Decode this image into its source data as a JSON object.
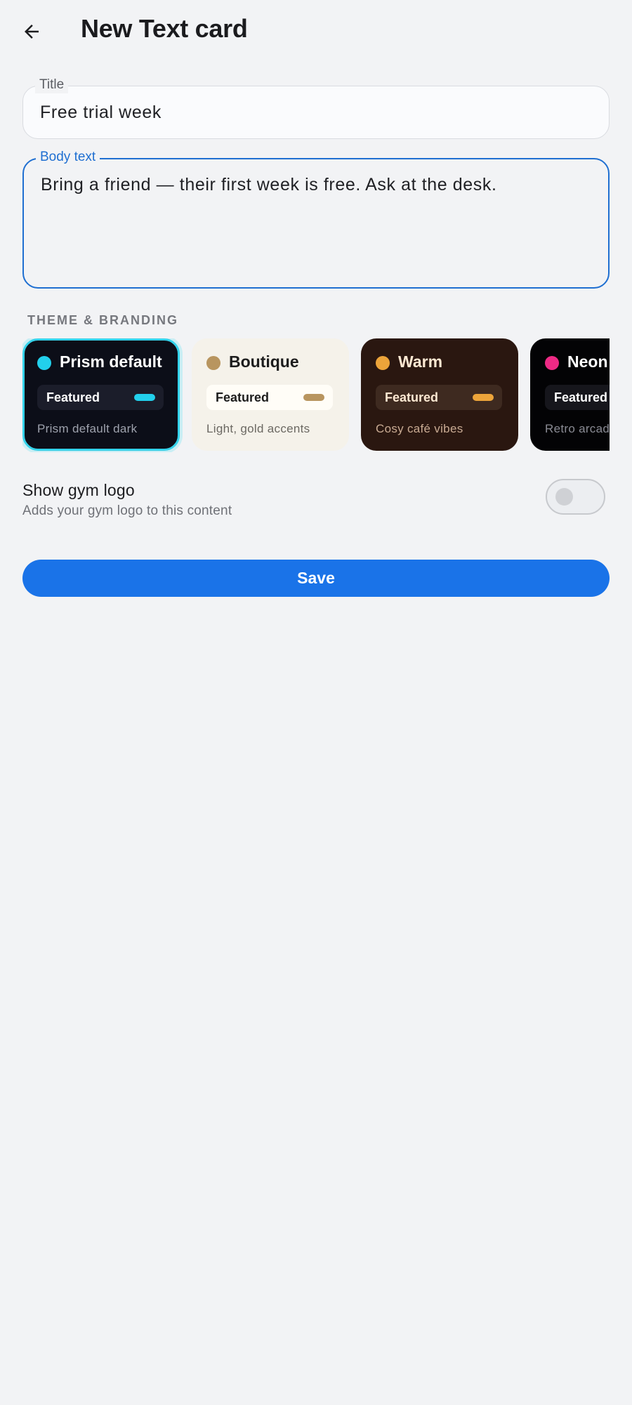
{
  "header": {
    "title": "New Text card"
  },
  "form": {
    "title_field": {
      "label": "Title",
      "value": "Free trial week"
    },
    "body_field": {
      "label": "Body text",
      "value": "Bring a friend — their first week is free. Ask at the desk."
    }
  },
  "theme": {
    "section_label": "THEME & BRANDING",
    "selected": "Prism default",
    "cards": [
      {
        "name": "Prism default",
        "featured_label": "Featured",
        "description": "Prism default dark",
        "accent": "#22d0ec"
      },
      {
        "name": "Boutique",
        "featured_label": "Featured",
        "description": "Light, gold accents",
        "accent": "#b8955f"
      },
      {
        "name": "Warm",
        "featured_label": "Featured",
        "description": "Cosy café vibes",
        "accent": "#eca43a"
      },
      {
        "name": "Neon",
        "featured_label": "Featured",
        "description": "Retro arcade",
        "accent": "#ee2a85"
      }
    ]
  },
  "logo_setting": {
    "title": "Show gym logo",
    "subtitle": "Adds your gym logo to this content",
    "enabled": false
  },
  "actions": {
    "save_label": "Save"
  },
  "colors": {
    "primary": "#1a73e8",
    "background": "#f2f3f5"
  }
}
